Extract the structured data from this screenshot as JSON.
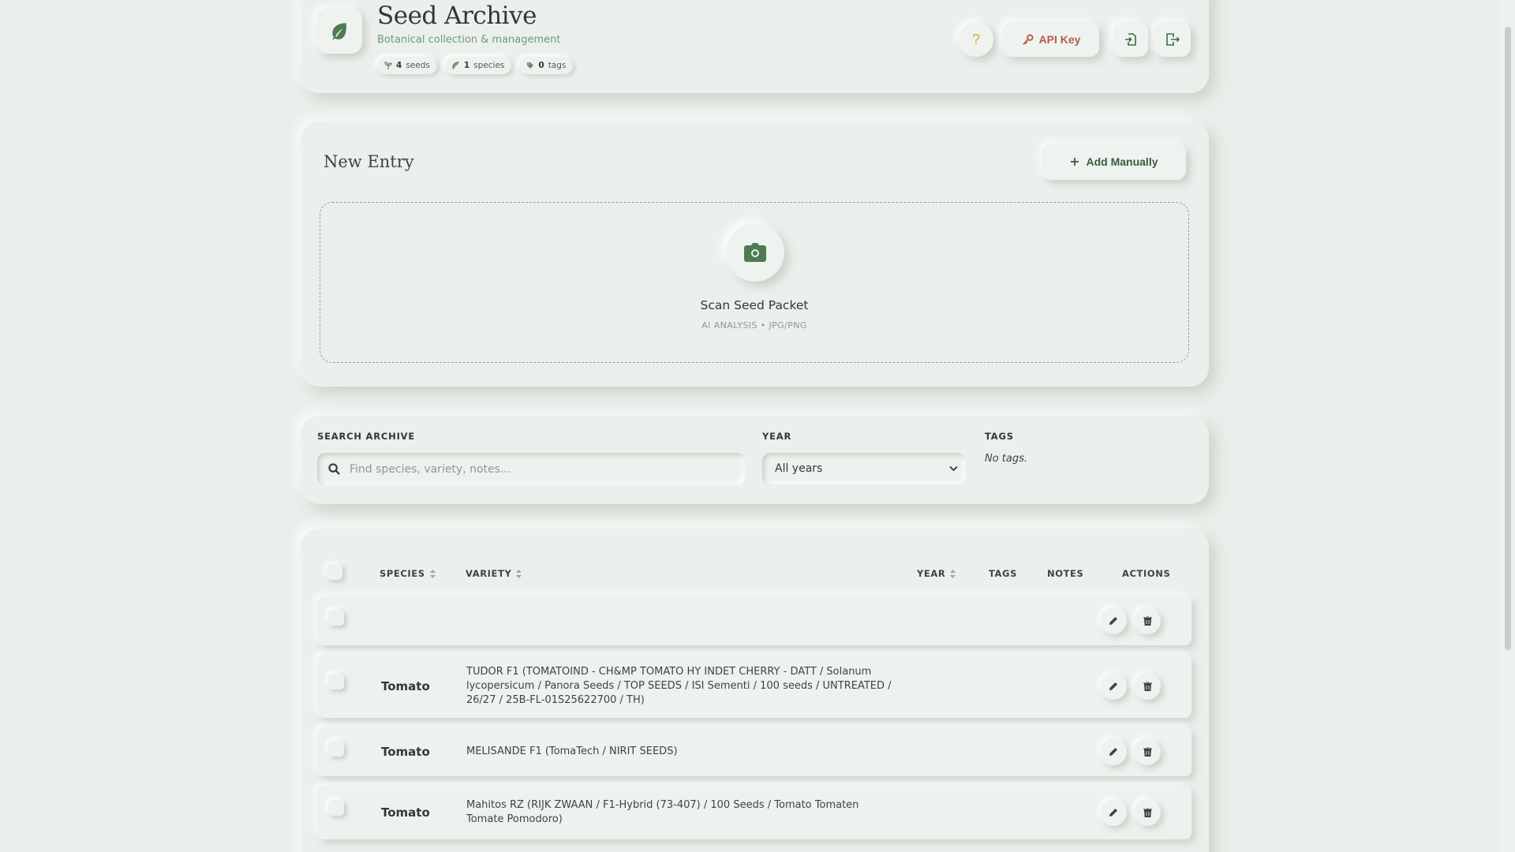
{
  "header": {
    "title": "Seed Archive",
    "subtitle": "Botanical collection & management",
    "stats": [
      {
        "value": "4",
        "label": "seeds",
        "icon": "sprout-icon"
      },
      {
        "value": "1",
        "label": "species",
        "icon": "leaf-icon"
      },
      {
        "value": "0",
        "label": "tags",
        "icon": "tag-icon"
      }
    ],
    "help_label": "?",
    "api_key_label": "API Key"
  },
  "new_entry": {
    "title": "New Entry",
    "add_manually_label": "Add Manually",
    "scan_title": "Scan Seed Packet",
    "scan_subtitle": "AI ANALYSIS • JPG/PNG"
  },
  "filters": {
    "search_label": "SEARCH ARCHIVE",
    "search_placeholder": "Find species, variety, notes...",
    "search_value": "",
    "year_label": "YEAR",
    "year_selected": "All years",
    "tags_label": "TAGS",
    "tags_empty": "No tags."
  },
  "table": {
    "columns": {
      "species": "SPECIES",
      "variety": "VARIETY",
      "year": "YEAR",
      "tags": "TAGS",
      "notes": "NOTES",
      "actions": "ACTIONS"
    },
    "rows": [
      {
        "species": "",
        "variety": "",
        "year": "",
        "tags": "",
        "notes": ""
      },
      {
        "species": "Tomato",
        "variety": "TUDOR F1 (TOMATOIND - CH&MP TOMATO HY INDET CHERRY - DATT / Solanum lycopersicum / Panora Seeds / TOP SEEDS / ISI Sementi / 100 seeds / UNTREATED / 26/27 / 25B-FL-01S25622700 / TH)",
        "year": "",
        "tags": "",
        "notes": ""
      },
      {
        "species": "Tomato",
        "variety": "MELISANDE F1 (TomaTech / NIRIT SEEDS)",
        "year": "",
        "tags": "",
        "notes": ""
      },
      {
        "species": "Tomato",
        "variety": "Mahitos RZ (RIJK ZWAAN / F1-Hybrid (73-407) / 100 Seeds / Tomato Tomaten Tomate Pomodoro)",
        "year": "",
        "tags": "",
        "notes": ""
      }
    ]
  },
  "colors": {
    "background": "#e9efea",
    "accent_green": "#4e7b53",
    "api_key_red": "#b85b4b",
    "help_yellow": "#d9a93a"
  }
}
